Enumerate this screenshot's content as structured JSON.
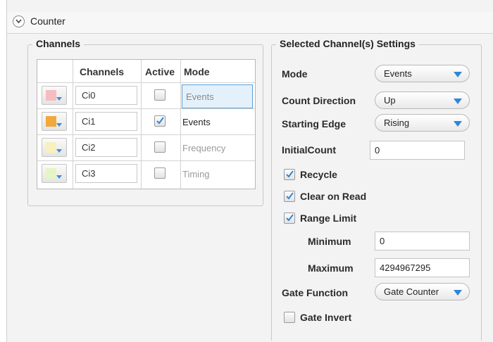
{
  "header": {
    "title": "Counter"
  },
  "channels_panel": {
    "title": "Channels",
    "columns": [
      "Channels",
      "Active",
      "Mode"
    ],
    "rows": [
      {
        "channel": "Ci0",
        "color": "#f6bcbf",
        "active": false,
        "mode": "Events",
        "mode_color": "#8a8a8a",
        "selected": true
      },
      {
        "channel": "Ci1",
        "color": "#f2a83b",
        "active": true,
        "mode": "Events",
        "mode_color": "#222222",
        "selected": false
      },
      {
        "channel": "Ci2",
        "color": "#f6f1bd",
        "active": false,
        "mode": "Frequency",
        "mode_color": "#9a9a9a",
        "selected": false
      },
      {
        "channel": "Ci3",
        "color": "#e6f5c4",
        "active": false,
        "mode": "Timing",
        "mode_color": "#9a9a9a",
        "selected": false
      }
    ]
  },
  "settings_panel": {
    "title": "Selected Channel(s) Settings",
    "mode": {
      "label": "Mode",
      "value": "Events"
    },
    "count_direction": {
      "label": "Count Direction",
      "value": "Up"
    },
    "starting_edge": {
      "label": "Starting Edge",
      "value": "Rising"
    },
    "initial_count": {
      "label": "InitialCount",
      "value": "0"
    },
    "recycle": {
      "label": "Recycle",
      "checked": true
    },
    "clear_on_read": {
      "label": "Clear on Read",
      "checked": true
    },
    "range_limit": {
      "label": "Range Limit",
      "checked": true
    },
    "minimum": {
      "label": "Minimum",
      "value": "0"
    },
    "maximum": {
      "label": "Maximum",
      "value": "4294967295"
    },
    "gate_function": {
      "label": "Gate Function",
      "value": "Gate Counter"
    },
    "gate_invert": {
      "label": "Gate Invert",
      "checked": false
    }
  },
  "colors": {
    "accent": "#2f86d6",
    "selection": "#e4f1fb",
    "border": "#c8c8c8"
  }
}
